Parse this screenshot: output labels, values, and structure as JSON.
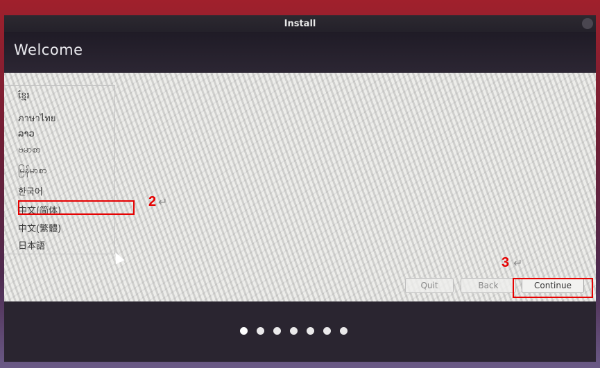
{
  "window": {
    "title": "Install",
    "heading": "Welcome"
  },
  "languages": [
    {
      "label": "ខ្មែរ"
    },
    {
      "label": "ภาษาไทย"
    },
    {
      "label": "ລາວ"
    },
    {
      "label": "ဗမာစာ"
    },
    {
      "label": "မြန်မာစာ"
    },
    {
      "label": "한국어"
    },
    {
      "label": "中文(简体)"
    },
    {
      "label": "中文(繁體)"
    },
    {
      "label": "日本語"
    }
  ],
  "buttons": {
    "quit": "Quit",
    "back": "Back",
    "continue": "Continue"
  },
  "annotations": {
    "step2": "2",
    "step3": "3",
    "arrow": "↵"
  },
  "progress": {
    "total_steps": 7,
    "current_step": 1
  },
  "colors": {
    "annotation": "#e60000"
  }
}
